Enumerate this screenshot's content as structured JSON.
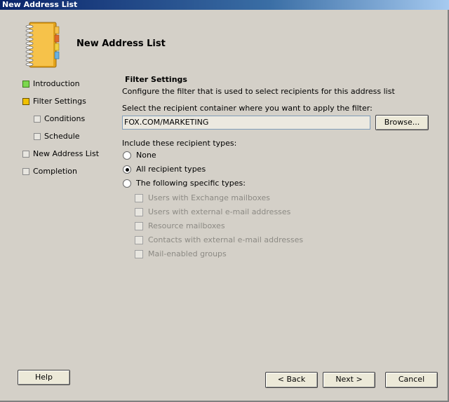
{
  "window": {
    "title": "New Address List"
  },
  "header": {
    "title": "New Address List",
    "icon": "address-book-icon"
  },
  "nav": {
    "items": [
      {
        "label": "Introduction",
        "status": "complete",
        "color": "#7cd84e"
      },
      {
        "label": "Filter Settings",
        "status": "current",
        "color": "#f0c000"
      },
      {
        "label": "Conditions",
        "status": "pending"
      },
      {
        "label": "Schedule",
        "status": "pending"
      },
      {
        "label": "New Address List",
        "status": "pending"
      },
      {
        "label": "Completion",
        "status": "pending"
      }
    ]
  },
  "filter": {
    "title": "Filter Settings",
    "description": "Configure the filter that is used to select recipients for this address list",
    "container_prompt": "Select the recipient container where you want to apply the filter:",
    "container_value": "FOX.COM/MARKETING",
    "browse_label": "Browse...",
    "recipient_types_prompt": "Include these recipient types:",
    "radios": [
      {
        "label": "None",
        "selected": false
      },
      {
        "label": "All recipient types",
        "selected": true
      },
      {
        "label": "The following specific types:",
        "selected": false
      }
    ],
    "specific_types": [
      {
        "label": "Users with Exchange mailboxes",
        "checked": false,
        "enabled": false
      },
      {
        "label": "Users with external e-mail addresses",
        "checked": false,
        "enabled": false
      },
      {
        "label": "Resource mailboxes",
        "checked": false,
        "enabled": false
      },
      {
        "label": "Contacts with external e-mail addresses",
        "checked": false,
        "enabled": false
      },
      {
        "label": "Mail-enabled groups",
        "checked": false,
        "enabled": false
      }
    ]
  },
  "footer": {
    "help_label": "Help",
    "back_label": "< Back",
    "next_label": "Next >",
    "cancel_label": "Cancel"
  }
}
